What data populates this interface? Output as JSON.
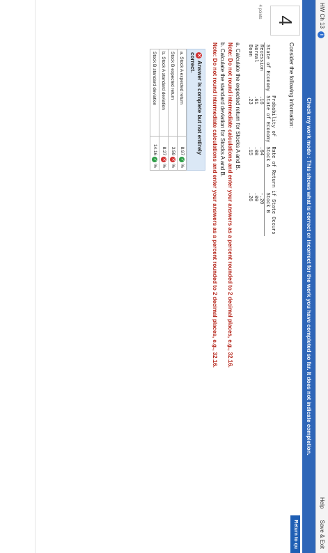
{
  "topbar": {
    "course": "HW Ch 13",
    "help": "Help",
    "save_exit": "Save & Exit"
  },
  "banner": "Check my work mode : This shows what is correct or incorrect for the work you have completed so far. It does not indicate completion.",
  "return_button": "Return to qu",
  "question": {
    "number": "4",
    "points": "4 points"
  },
  "prompt": "Consider the following information:",
  "table": {
    "header1": [
      "",
      "Probability of",
      "Rate of Return if State Occurs"
    ],
    "header2": [
      "State of Economy",
      "State of Economy",
      "Stock A",
      "Stock B"
    ],
    "rows": [
      [
        "Recession",
        ".16",
        ".04",
        "-.20"
      ],
      [
        "Normal",
        ".61",
        ".08",
        ".09"
      ],
      [
        "Boom",
        ".23",
        ".15",
        ".26"
      ]
    ]
  },
  "part_a": "a. Calculate the expected return for Stocks A and B.",
  "note_a": "Note: Do not round intermediate calculations and enter your answers as a percent rounded to 2 decimal places, e.g., 32.16.",
  "part_b": "b. Calculate the standard deviation for Stocks A and B.",
  "note_b": "Note: Do not round intermediate calculations and enter your answers as a percent rounded to 2 decimal places, e.g., 32.16.",
  "answer": {
    "header": "Answer is complete but not entirely correct.",
    "rows": [
      {
        "label": "a. Stock A expected return",
        "value": "8.97",
        "status": "correct",
        "unit": "%"
      },
      {
        "label": "Stock B expected return",
        "value": "3.59",
        "status": "incorrect",
        "unit": "%"
      },
      {
        "label": "b. Stock A standard deviation",
        "value": "8.27",
        "status": "incorrect",
        "unit": "%"
      },
      {
        "label": "Stock B standard deviation",
        "value": "14.16",
        "status": "correct",
        "unit": "%"
      }
    ]
  },
  "colors": {
    "banner": "#2e66b8",
    "correct": "#2e9e47",
    "incorrect": "#d12f2f",
    "note": "#b42318"
  }
}
